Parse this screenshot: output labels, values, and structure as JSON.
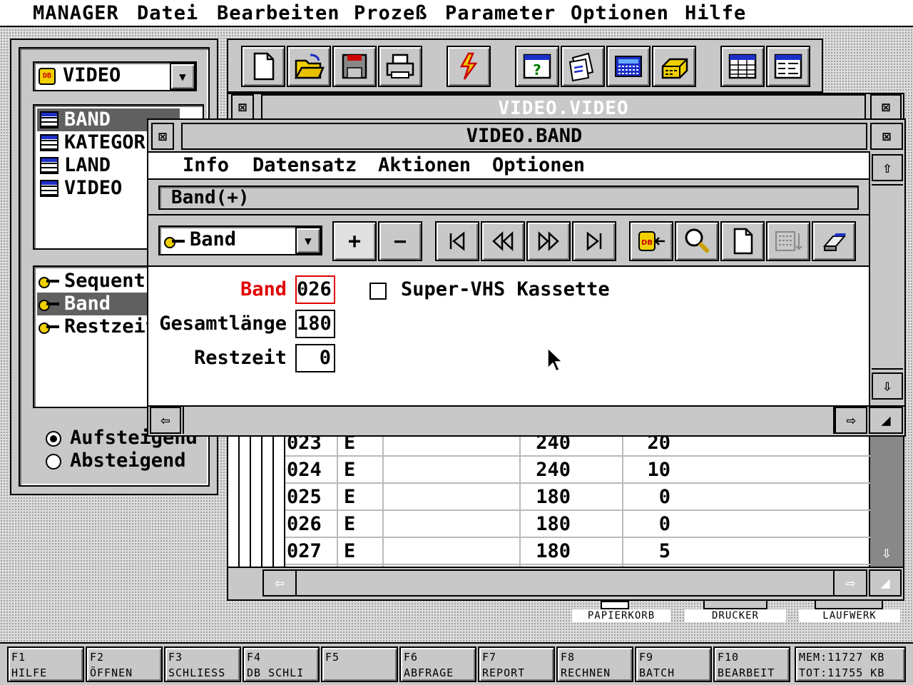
{
  "menubar": {
    "items": [
      "MANAGER",
      "Datei",
      "Bearbeiten",
      "Prozeß",
      "Parameter",
      "Optionen",
      "Hilfe"
    ]
  },
  "left_panel": {
    "database_select": "VIDEO",
    "tables": [
      {
        "label": "BAND",
        "selected": true
      },
      {
        "label": "KATEGORI",
        "selected": false
      },
      {
        "label": "LAND",
        "selected": false
      },
      {
        "label": "VIDEO",
        "selected": false
      }
    ],
    "indexes": [
      {
        "label": "Sequent:",
        "selected": false
      },
      {
        "label": "Band",
        "selected": true
      },
      {
        "label": "Restzeit",
        "selected": false
      }
    ],
    "sort": {
      "ascending": "Aufsteigend",
      "descending": "Absteigend",
      "selected": "ascending"
    }
  },
  "back_window": {
    "title": "VIDEO.VIDEO",
    "rows": [
      {
        "band": "023",
        "type": "E",
        "length": "240",
        "rest": "20"
      },
      {
        "band": "024",
        "type": "E",
        "length": "240",
        "rest": "10"
      },
      {
        "band": "025",
        "type": "E",
        "length": "180",
        "rest": "0"
      },
      {
        "band": "026",
        "type": "E",
        "length": "180",
        "rest": "0"
      },
      {
        "band": "027",
        "type": "E",
        "length": "180",
        "rest": "5"
      }
    ]
  },
  "front_window": {
    "title": "VIDEO.BAND",
    "menu": [
      "Info",
      "Datensatz",
      "Aktionen",
      "Optionen"
    ],
    "status": "Band(+)",
    "index_select": "Band",
    "form": {
      "band_label": "Band",
      "band_value": "026",
      "checkbox_label": "Super-VHS Kassette",
      "checkbox_checked": false,
      "gesamt_label": "Gesamtlänge",
      "gesamt_value": "180",
      "rest_label": "Restzeit",
      "rest_value": "0"
    }
  },
  "desktop_icons": [
    "PAPIERKORB",
    "DRUCKER",
    "LAUFWERK"
  ],
  "function_keys": [
    {
      "key": "F1",
      "label": "HILFE"
    },
    {
      "key": "F2",
      "label": "ÖFFNEN"
    },
    {
      "key": "F3",
      "label": "SCHLIESS"
    },
    {
      "key": "F4",
      "label": "DB SCHLI"
    },
    {
      "key": "F5",
      "label": ""
    },
    {
      "key": "F6",
      "label": "ABFRAGE"
    },
    {
      "key": "F7",
      "label": "REPORT"
    },
    {
      "key": "F8",
      "label": "RECHNEN"
    },
    {
      "key": "F9",
      "label": "BATCH"
    },
    {
      "key": "F10",
      "label": "BEARBEIT"
    }
  ],
  "memory": {
    "mem": "MEM:11727 KB",
    "tot": "TOT:11755 KB"
  },
  "colors": {
    "accent_red": "#e00000",
    "selection": "#1c2fc9"
  }
}
